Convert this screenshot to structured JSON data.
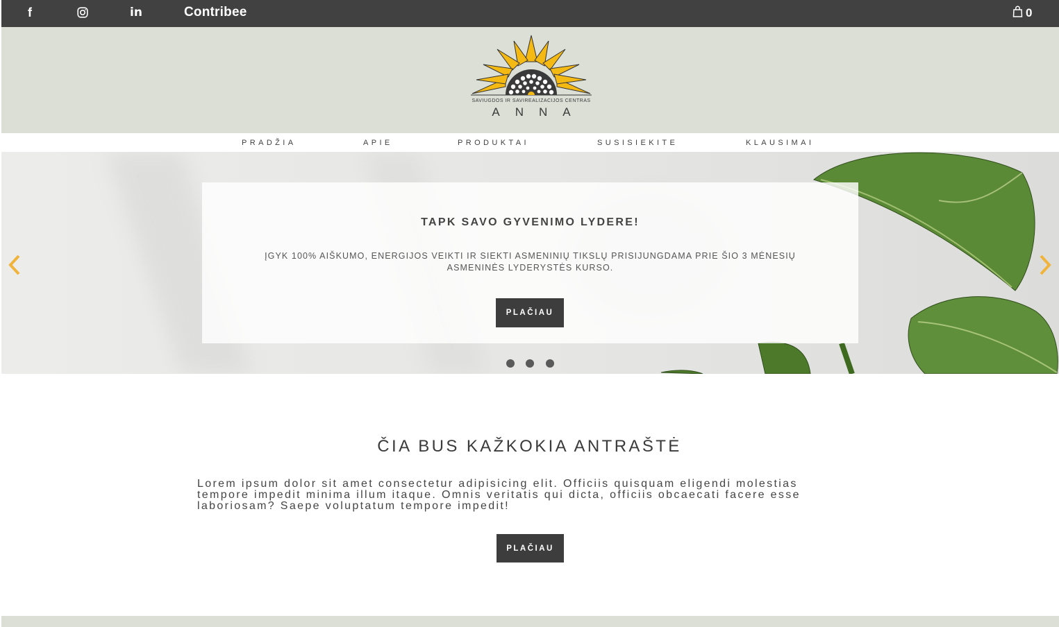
{
  "topbar": {
    "brand": "Contribee",
    "social": [
      {
        "icon": "facebook-icon",
        "glyph": "f"
      },
      {
        "icon": "instagram-icon"
      },
      {
        "icon": "linkedin-icon",
        "glyph": "in"
      }
    ],
    "cart_count": "0"
  },
  "logo": {
    "subtitle": "SAVIUGDOS IR SAVIREALIZACIJOS CENTRAS",
    "name": "ANNA"
  },
  "nav": {
    "items": [
      "PRADŽIA",
      "APIE",
      "PRODUKTAI",
      "SUSISIEKITE",
      "KLAUSIMAI"
    ]
  },
  "hero": {
    "title": "TAPK SAVO GYVENIMO LYDERE!",
    "text": "ĮGYK 100% AIŠKUMO, ENERGIJOS VEIKTI IR SIEKTI ASMENINIŲ TIKSLŲ PRISIJUNGDAMA PRIE ŠIO 3 MĖNESIŲ ASMENINĖS LYDERYSTĖS KURSO.",
    "button": "PLAČIAU",
    "slide_count": 3
  },
  "section": {
    "title": "ČIA BUS KAŽKOKIA ANTRAŠTĖ",
    "text": "Lorem ipsum dolor sit amet consectetur adipisicing elit. Officiis quisquam eligendi molestias tempore impedit minima illum itaque. Omnis veritatis qui dicta, officiis obcaecati facere esse laboriosam? Saepe voluptatum tempore impedit!",
    "button": "PLAČIAU"
  },
  "colors": {
    "topbar": "#414141",
    "header_bg": "#dcdfd6",
    "button": "#3d3d3d",
    "sunflower": "#f5b914",
    "arrow": "#f0b43c"
  }
}
